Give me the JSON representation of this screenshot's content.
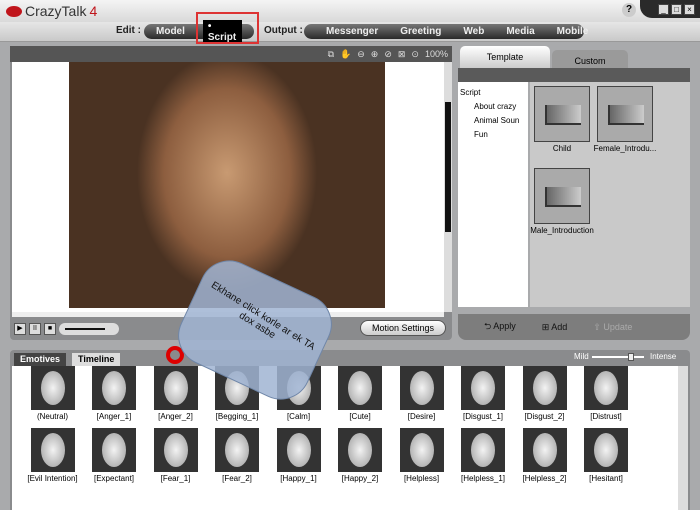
{
  "app": {
    "name": "CrazyTalk",
    "version": "4",
    "help": "?"
  },
  "nav": {
    "edit_label": "Edit :",
    "edit": [
      "Model",
      "Script"
    ],
    "active": "Script",
    "output_label": "Output :",
    "output": [
      "Messenger",
      "Greeting",
      "Web",
      "Media",
      "Mobile"
    ]
  },
  "viewer": {
    "zoom": "100%",
    "motion_settings": "Motion Settings"
  },
  "right": {
    "tabs": [
      "Template",
      "Custom"
    ],
    "tree": [
      "Script",
      "About crazy",
      "Animal Soun",
      "Fun"
    ],
    "templates": [
      "Child",
      "Female_Introdu...",
      "Male_Introduction"
    ],
    "apply": "Apply",
    "add": "Add",
    "update": "Update"
  },
  "bottom": {
    "tabs": [
      "Emotives",
      "Timeline"
    ],
    "mild": "Mild",
    "intense": "Intense",
    "intensity": 0.75,
    "faces": [
      "(Neutral)",
      "[Anger_1]",
      "[Anger_2]",
      "[Begging_1]",
      "[Calm]",
      "[Cute]",
      "[Desire]",
      "[Disgust_1]",
      "[Disgust_2]",
      "[Distrust]",
      "[Evil Intention]",
      "[Expectant]",
      "[Fear_1]",
      "[Fear_2]",
      "[Happy_1]",
      "[Happy_2]",
      "[Helpless]",
      "[Helpless_1]",
      "[Helpless_2]",
      "[Hesitant]"
    ]
  },
  "callout": {
    "text": "Ekhane click korle ar ek TA dox asbe"
  }
}
